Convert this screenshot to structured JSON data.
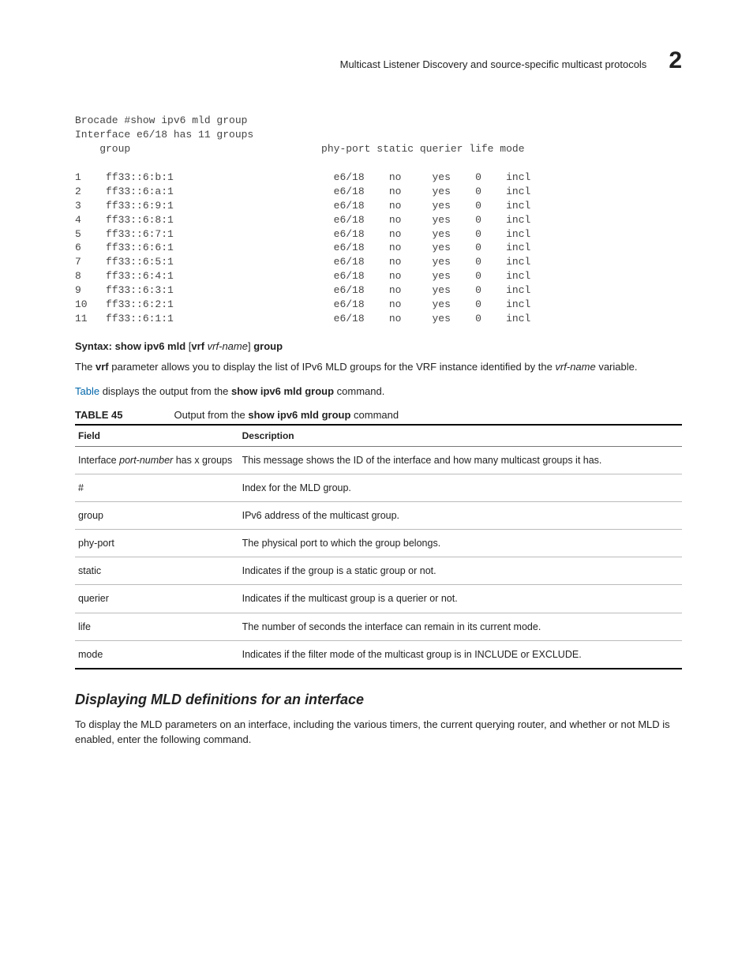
{
  "header": {
    "title": "Multicast Listener Discovery and source-specific multicast protocols",
    "chapter": "2"
  },
  "code": "Brocade #show ipv6 mld group\nInterface e6/18 has 11 groups\n    group                               phy-port static querier life mode\n\n1    ff33::6:b:1                          e6/18    no     yes    0    incl\n2    ff33::6:a:1                          e6/18    no     yes    0    incl\n3    ff33::6:9:1                          e6/18    no     yes    0    incl\n4    ff33::6:8:1                          e6/18    no     yes    0    incl\n5    ff33::6:7:1                          e6/18    no     yes    0    incl\n6    ff33::6:6:1                          e6/18    no     yes    0    incl\n7    ff33::6:5:1                          e6/18    no     yes    0    incl\n8    ff33::6:4:1                          e6/18    no     yes    0    incl\n9    ff33::6:3:1                          e6/18    no     yes    0    incl\n10   ff33::6:2:1                          e6/18    no     yes    0    incl\n11   ff33::6:1:1                          e6/18    no     yes    0    incl",
  "syntax": {
    "label": "Syntax:",
    "cmd_pre": "show ipv6 mld",
    "opt_open": "[",
    "opt_kw": "vrf",
    "opt_var": "vrf-name",
    "opt_close": "]",
    "cmd_post": "group"
  },
  "para1_a": "The ",
  "para1_b": "vrf",
  "para1_c": " parameter allows you to display the list of IPv6 MLD groups for the VRF instance identified by the ",
  "para1_d": "vrf-name",
  "para1_e": " variable.",
  "para2_link": "Table",
  "para2_a": " displays the output from the ",
  "para2_cmd": "show ipv6 mld group",
  "para2_b": " command.",
  "table_caption_label": "TABLE 45",
  "table_caption_a": "Output from the ",
  "table_caption_cmd": "show ipv6 mld group",
  "table_caption_b": " command",
  "table_headers": {
    "field": "Field",
    "desc": "Description"
  },
  "table_rows": [
    {
      "field_a": "Interface ",
      "field_i": "port-number",
      "field_b": " has x groups",
      "desc": "This message shows the ID of the interface and how many multicast groups it has."
    },
    {
      "field_a": "#",
      "desc": "Index for the MLD group."
    },
    {
      "field_a": "group",
      "desc": "IPv6 address of the multicast group."
    },
    {
      "field_a": "phy-port",
      "desc": "The physical port to which the group belongs."
    },
    {
      "field_a": "static",
      "desc": "Indicates if the group is a static group or not."
    },
    {
      "field_a": "querier",
      "desc": "Indicates if the multicast group is a querier or not."
    },
    {
      "field_a": "life",
      "desc": "The number of seconds the interface can remain in its current mode."
    },
    {
      "field_a": "mode",
      "desc": "Indicates if the filter mode of the multicast group is in INCLUDE or EXCLUDE."
    }
  ],
  "sub_heading": "Displaying MLD definitions for an interface",
  "para3": "To display the MLD parameters on an interface, including the various timers, the current querying router, and whether or not MLD is enabled, enter the following command."
}
